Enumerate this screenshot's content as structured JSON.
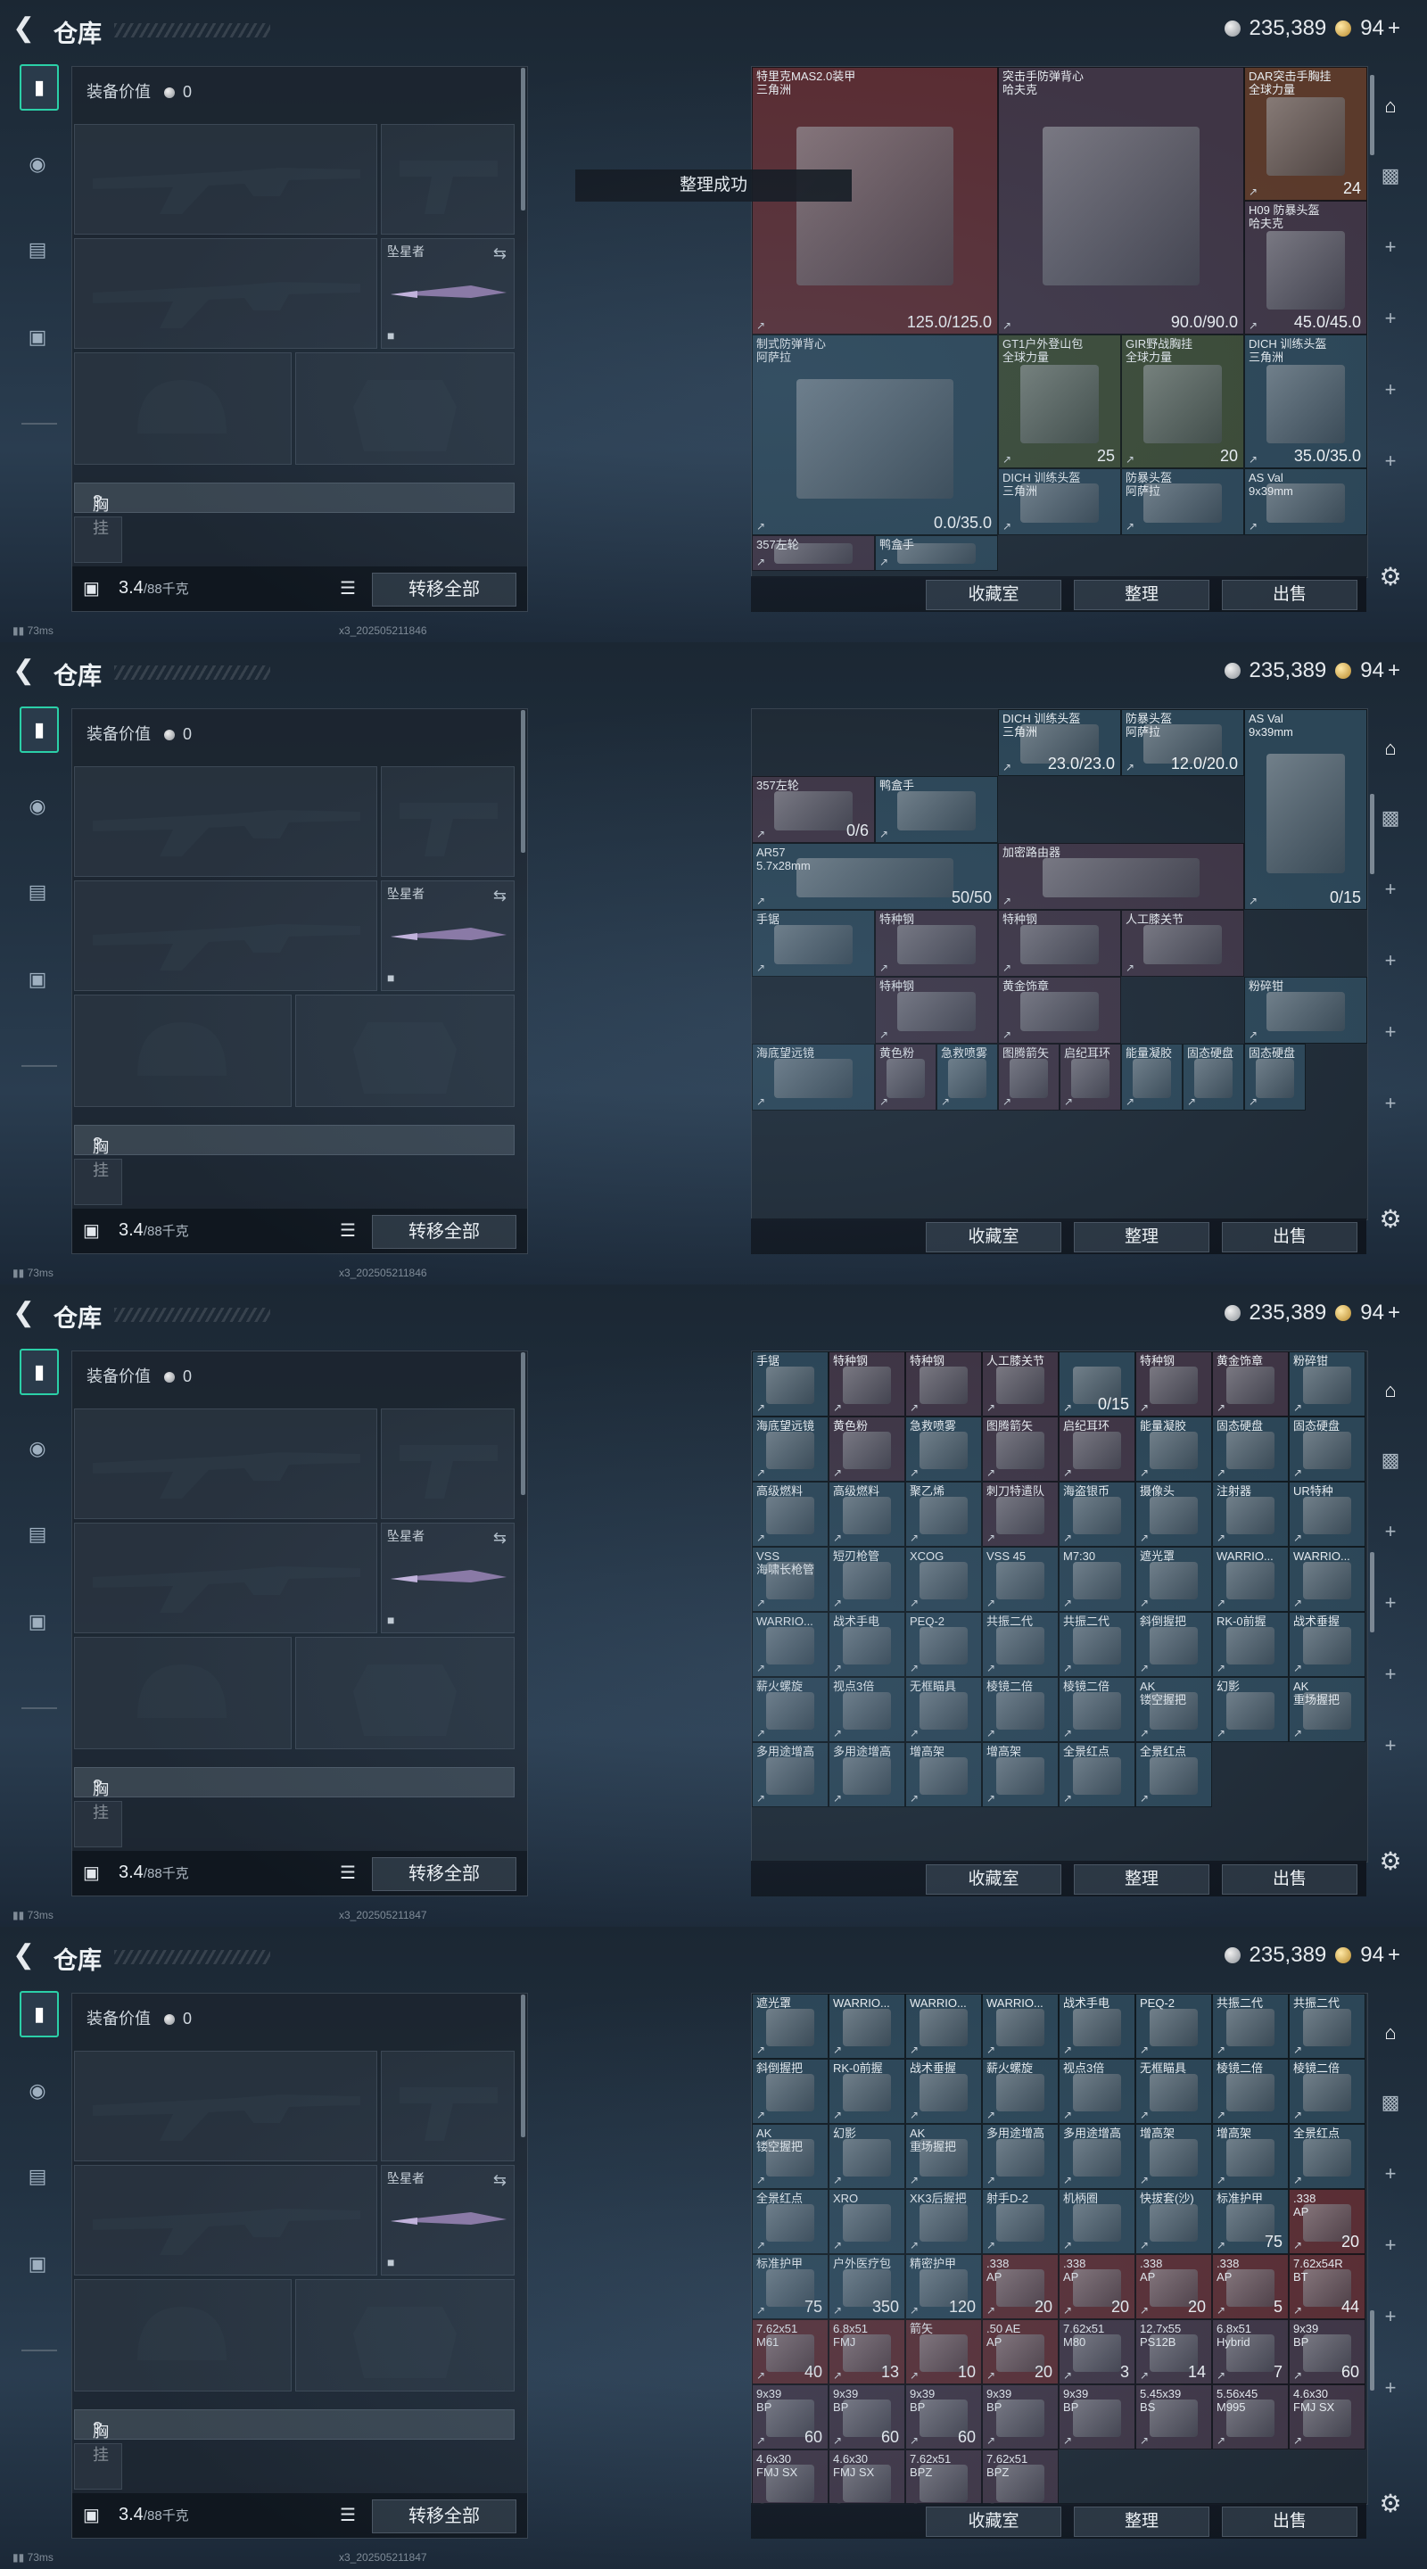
{
  "header": {
    "title": "仓库",
    "silver": "235,389",
    "gold": "94",
    "plus": "+"
  },
  "loadout": {
    "equip_value_label": "装备价值",
    "equip_value": "0",
    "melee_label": "坠星者",
    "vest_label": "胸挂",
    "vest_help": "?",
    "weight_current": "3.4",
    "weight_max": "/88千克",
    "transfer_all": "转移全部"
  },
  "storage_buttons": {
    "collection": "收藏室",
    "arrange": "整理",
    "sell": "出售"
  },
  "toast": "整理成功",
  "status": {
    "ping": "73ms",
    "build_1": "x3_202505211846",
    "build_2": "x3_202505211847"
  },
  "screens": [
    {
      "cells": [
        {
          "name": "特里克MAS2.0装甲\n三角洲",
          "qty": "125.0/125.0",
          "bg": "#5a2d33"
        },
        {
          "name": "突击手防弹背心\n哈夫克",
          "qty": "90.0/90.0",
          "bg": "#3f3545"
        },
        {
          "name": "DAR突击手胸挂\n全球力量",
          "qty": "24",
          "bg": "#5b3a2b"
        },
        {
          "name": "H09 防暴头盔\n哈夫克",
          "qty": "45.0/45.0",
          "bg": "#3f3545"
        },
        {
          "name": "制式防弹背心\n阿萨拉",
          "qty": "0.0/35.0",
          "bg": "#2c4657"
        },
        {
          "name": "GT1户外登山包\n全球力量",
          "qty": "25",
          "bg": "#3b4a35"
        },
        {
          "name": "GIR野战胸挂\n全球力量",
          "qty": "20",
          "bg": "#3b4a35"
        },
        {
          "name": "DICH 训练头盔\n三角洲",
          "qty": "35.0/35.0",
          "bg": "#2c4657"
        },
        {
          "name": "DICH 训练头盔\n三角洲",
          "qty": "",
          "bg": "#2c4657"
        },
        {
          "name": "防暴头盔\n阿萨拉",
          "qty": "",
          "bg": "#2c4657"
        },
        {
          "name": "AS Val\n9x39mm",
          "qty": "",
          "bg": "#2c4657"
        },
        {
          "name": "357左轮",
          "qty": "",
          "bg": "#3f3545"
        },
        {
          "name": "鸭盒手",
          "qty": "",
          "bg": "#2c4657"
        }
      ]
    },
    {
      "cells": [
        {
          "name": "DICH 训练头盔\n三角洲",
          "qty": "23.0/23.0",
          "bg": "#2c4657"
        },
        {
          "name": "防暴头盔\n阿萨拉",
          "qty": "12.0/20.0",
          "bg": "#2c4657"
        },
        {
          "name": "AS Val\n9x39mm",
          "qty": "0/15",
          "bg": "#2c4657"
        },
        {
          "name": "357左轮",
          "qty": "0/6",
          "bg": "#3f3545"
        },
        {
          "name": "鸭盒手",
          "qty": "",
          "bg": "#2c4657"
        },
        {
          "name": "AR57\n5.7x28mm",
          "qty": "50/50",
          "bg": "#2c4657"
        },
        {
          "name": "加密路由器",
          "qty": "",
          "bg": "#3f3545"
        },
        {
          "name": "手锯",
          "qty": "",
          "bg": "#2c4657"
        },
        {
          "name": "特种钢",
          "qty": "",
          "bg": "#3f3545"
        },
        {
          "name": "特种钢",
          "qty": "",
          "bg": "#3f3545"
        },
        {
          "name": "人工膝关节",
          "qty": "",
          "bg": "#3f3545"
        },
        {
          "name": "特种钢",
          "qty": "",
          "bg": "#3f3545"
        },
        {
          "name": "黄金饰章",
          "qty": "",
          "bg": "#3f3545"
        },
        {
          "name": "粉碎钳",
          "qty": "",
          "bg": "#2c4657"
        },
        {
          "name": "海底望远镜",
          "qty": "",
          "bg": "#2c4657"
        },
        {
          "name": "黄色粉",
          "qty": "",
          "bg": "#3f3545"
        },
        {
          "name": "急救喷雾",
          "qty": "",
          "bg": "#2c4657"
        },
        {
          "name": "图腾箭矢",
          "qty": "",
          "bg": "#3f3545"
        },
        {
          "name": "启纪耳环",
          "qty": "",
          "bg": "#3f3545"
        },
        {
          "name": "能量凝胶",
          "qty": "",
          "bg": "#2c4657"
        },
        {
          "name": "固态硬盘",
          "qty": "",
          "bg": "#2c4657"
        },
        {
          "name": "固态硬盘",
          "qty": "",
          "bg": "#2c4657"
        }
      ]
    },
    {
      "cells": [
        {
          "name": "手锯",
          "qty": "",
          "bg": "#2c4657"
        },
        {
          "name": "特种钢",
          "qty": "",
          "bg": "#3f3545"
        },
        {
          "name": "特种钢",
          "qty": "",
          "bg": "#3f3545"
        },
        {
          "name": "人工膝关节",
          "qty": "",
          "bg": "#3f3545"
        },
        {
          "name": "",
          "qty": "0/15",
          "bg": "#2c4657"
        },
        {
          "name": "特种钢",
          "qty": "",
          "bg": "#3f3545"
        },
        {
          "name": "黄金饰章",
          "qty": "",
          "bg": "#3f3545"
        },
        {
          "name": "粉碎钳",
          "qty": "",
          "bg": "#2c4657"
        },
        {
          "name": "海底望远镜",
          "qty": "",
          "bg": "#2c4657"
        },
        {
          "name": "黄色粉",
          "qty": "",
          "bg": "#3f3545"
        },
        {
          "name": "急救喷雾",
          "qty": "",
          "bg": "#2c4657"
        },
        {
          "name": "图腾箭矢",
          "qty": "",
          "bg": "#3f3545"
        },
        {
          "name": "启纪耳环",
          "qty": "",
          "bg": "#3f3545"
        },
        {
          "name": "能量凝胶",
          "qty": "",
          "bg": "#2c4657"
        },
        {
          "name": "固态硬盘",
          "qty": "",
          "bg": "#2c4657"
        },
        {
          "name": "固态硬盘",
          "qty": "",
          "bg": "#2c4657"
        },
        {
          "name": "高级燃料",
          "qty": "",
          "bg": "#2c4657"
        },
        {
          "name": "高级燃料",
          "qty": "",
          "bg": "#2c4657"
        },
        {
          "name": "聚乙烯",
          "qty": "",
          "bg": "#2c4657"
        },
        {
          "name": "刺刀特遣队",
          "qty": "",
          "bg": "#3f3545"
        },
        {
          "name": "海盗银币",
          "qty": "",
          "bg": "#2c4657"
        },
        {
          "name": "摄像头",
          "qty": "",
          "bg": "#2c4657"
        },
        {
          "name": "注射器",
          "qty": "",
          "bg": "#2c4657"
        },
        {
          "name": "UR特种",
          "qty": "",
          "bg": "#2c4657"
        },
        {
          "name": "VSS\n海啸长枪管",
          "qty": "",
          "bg": "#2c4657"
        },
        {
          "name": "短刃枪管",
          "qty": "",
          "bg": "#2c4657"
        },
        {
          "name": "XCOG",
          "qty": "",
          "bg": "#2c4657"
        },
        {
          "name": "VSS 45",
          "qty": "",
          "bg": "#2c4657"
        },
        {
          "name": "M7:30",
          "qty": "",
          "bg": "#2c4657"
        },
        {
          "name": "遮光罩",
          "qty": "",
          "bg": "#2c4657"
        },
        {
          "name": "WARRIO...",
          "qty": "",
          "bg": "#2c4657"
        },
        {
          "name": "WARRIO...",
          "qty": "",
          "bg": "#2c4657"
        },
        {
          "name": "WARRIO...",
          "qty": "",
          "bg": "#2c4657"
        },
        {
          "name": "战术手电",
          "qty": "",
          "bg": "#2c4657"
        },
        {
          "name": "PEQ-2",
          "qty": "",
          "bg": "#2c4657"
        },
        {
          "name": "共振二代",
          "qty": "",
          "bg": "#2c4657"
        },
        {
          "name": "共振二代",
          "qty": "",
          "bg": "#2c4657"
        },
        {
          "name": "斜倒握把",
          "qty": "",
          "bg": "#2c4657"
        },
        {
          "name": "RK-0前握",
          "qty": "",
          "bg": "#2c4657"
        },
        {
          "name": "战术垂握",
          "qty": "",
          "bg": "#2c4657"
        },
        {
          "name": "薪火螺旋",
          "qty": "",
          "bg": "#2c4657"
        },
        {
          "name": "视点3倍",
          "qty": "",
          "bg": "#2c4657"
        },
        {
          "name": "无框瞄具",
          "qty": "",
          "bg": "#2c4657"
        },
        {
          "name": "棱镜二倍",
          "qty": "",
          "bg": "#2c4657"
        },
        {
          "name": "棱镜二倍",
          "qty": "",
          "bg": "#2c4657"
        },
        {
          "name": "AK\n镂空握把",
          "qty": "",
          "bg": "#2c4657"
        },
        {
          "name": "幻影",
          "qty": "",
          "bg": "#2c4657"
        },
        {
          "name": "AK\n重场握把",
          "qty": "",
          "bg": "#2c4657"
        },
        {
          "name": "多用途增高",
          "qty": "",
          "bg": "#2c4657"
        },
        {
          "name": "多用途增高",
          "qty": "",
          "bg": "#2c4657"
        },
        {
          "name": "增高架",
          "qty": "",
          "bg": "#2c4657"
        },
        {
          "name": "增高架",
          "qty": "",
          "bg": "#2c4657"
        },
        {
          "name": "全景红点",
          "qty": "",
          "bg": "#2c4657"
        },
        {
          "name": "全景红点",
          "qty": "",
          "bg": "#2c4657"
        }
      ]
    },
    {
      "cells": [
        {
          "name": "遮光罩",
          "qty": "",
          "bg": "#2c4657"
        },
        {
          "name": "WARRIO...",
          "qty": "",
          "bg": "#2c4657"
        },
        {
          "name": "WARRIO...",
          "qty": "",
          "bg": "#2c4657"
        },
        {
          "name": "WARRIO...",
          "qty": "",
          "bg": "#2c4657"
        },
        {
          "name": "战术手电",
          "qty": "",
          "bg": "#2c4657"
        },
        {
          "name": "PEQ-2",
          "qty": "",
          "bg": "#2c4657"
        },
        {
          "name": "共振二代",
          "qty": "",
          "bg": "#2c4657"
        },
        {
          "name": "共振二代",
          "qty": "",
          "bg": "#2c4657"
        },
        {
          "name": "斜倒握把",
          "qty": "",
          "bg": "#2c4657"
        },
        {
          "name": "RK-0前握",
          "qty": "",
          "bg": "#2c4657"
        },
        {
          "name": "战术垂握",
          "qty": "",
          "bg": "#2c4657"
        },
        {
          "name": "薪火螺旋",
          "qty": "",
          "bg": "#2c4657"
        },
        {
          "name": "视点3倍",
          "qty": "",
          "bg": "#2c4657"
        },
        {
          "name": "无框瞄具",
          "qty": "",
          "bg": "#2c4657"
        },
        {
          "name": "棱镜二倍",
          "qty": "",
          "bg": "#2c4657"
        },
        {
          "name": "棱镜二倍",
          "qty": "",
          "bg": "#2c4657"
        },
        {
          "name": "AK\n镂空握把",
          "qty": "",
          "bg": "#2c4657"
        },
        {
          "name": "幻影",
          "qty": "",
          "bg": "#2c4657"
        },
        {
          "name": "AK\n重场握把",
          "qty": "",
          "bg": "#2c4657"
        },
        {
          "name": "多用途增高",
          "qty": "",
          "bg": "#2c4657"
        },
        {
          "name": "多用途增高",
          "qty": "",
          "bg": "#2c4657"
        },
        {
          "name": "增高架",
          "qty": "",
          "bg": "#2c4657"
        },
        {
          "name": "增高架",
          "qty": "",
          "bg": "#2c4657"
        },
        {
          "name": "全景红点",
          "qty": "",
          "bg": "#2c4657"
        },
        {
          "name": "全景红点",
          "qty": "",
          "bg": "#2c4657"
        },
        {
          "name": "XRO",
          "qty": "",
          "bg": "#2c4657"
        },
        {
          "name": "XK3后握把",
          "qty": "",
          "bg": "#2c4657"
        },
        {
          "name": "射手D-2",
          "qty": "",
          "bg": "#2c4657"
        },
        {
          "name": "机柄圈",
          "qty": "",
          "bg": "#2c4657"
        },
        {
          "name": "快拔套(沙)",
          "qty": "",
          "bg": "#2c4657"
        },
        {
          "name": "标准护甲",
          "qty": "75",
          "bg": "#2c4657"
        },
        {
          "name": ".338\nAP",
          "qty": "20",
          "bg": "#5a2d33"
        },
        {
          "name": "标准护甲",
          "qty": "75",
          "bg": "#2c4657"
        },
        {
          "name": "户外医疗包",
          "qty": "350",
          "bg": "#2c4657"
        },
        {
          "name": "精密护甲",
          "qty": "120",
          "bg": "#2c4657"
        },
        {
          "name": ".338\nAP",
          "qty": "20",
          "bg": "#5a2d33"
        },
        {
          "name": ".338\nAP",
          "qty": "20",
          "bg": "#5a2d33"
        },
        {
          "name": ".338\nAP",
          "qty": "20",
          "bg": "#5a2d33"
        },
        {
          "name": ".338\nAP",
          "qty": "5",
          "bg": "#5a2d33"
        },
        {
          "name": "7.62x54R\nBT",
          "qty": "44",
          "bg": "#5a2d33"
        },
        {
          "name": "7.62x51\nM61",
          "qty": "40",
          "bg": "#5a2d33"
        },
        {
          "name": "6.8x51\nFMJ",
          "qty": "13",
          "bg": "#5a2d33"
        },
        {
          "name": "箭矢",
          "qty": "10",
          "bg": "#5a2d33"
        },
        {
          "name": ".50 AE\nAP",
          "qty": "20",
          "bg": "#5a2d33"
        },
        {
          "name": "7.62x51\nM80",
          "qty": "3",
          "bg": "#3f3545"
        },
        {
          "name": "12.7x55\nPS12B",
          "qty": "14",
          "bg": "#3f3545"
        },
        {
          "name": "6.8x51\nHybrid",
          "qty": "7",
          "bg": "#3f3545"
        },
        {
          "name": "9x39\nBP",
          "qty": "60",
          "bg": "#3f3545"
        },
        {
          "name": "9x39\nBP",
          "qty": "60",
          "bg": "#3f3545"
        },
        {
          "name": "9x39\nBP",
          "qty": "60",
          "bg": "#3f3545"
        },
        {
          "name": "9x39\nBP",
          "qty": "60",
          "bg": "#3f3545"
        },
        {
          "name": "9x39\nBP",
          "qty": "",
          "bg": "#3f3545"
        },
        {
          "name": "9x39\nBP",
          "qty": "",
          "bg": "#3f3545"
        },
        {
          "name": "5.45x39\nBS",
          "qty": "",
          "bg": "#3f3545"
        },
        {
          "name": "5.56x45\nM995",
          "qty": "",
          "bg": "#3f3545"
        },
        {
          "name": "4.6x30\nFMJ SX",
          "qty": "",
          "bg": "#3f3545"
        },
        {
          "name": "4.6x30\nFMJ SX",
          "qty": "",
          "bg": "#3f3545"
        },
        {
          "name": "4.6x30\nFMJ SX",
          "qty": "",
          "bg": "#3f3545"
        },
        {
          "name": "7.62x51\nBPZ",
          "qty": "",
          "bg": "#3f3545"
        },
        {
          "name": "7.62x51\nBPZ",
          "qty": "",
          "bg": "#3f3545"
        }
      ]
    }
  ]
}
